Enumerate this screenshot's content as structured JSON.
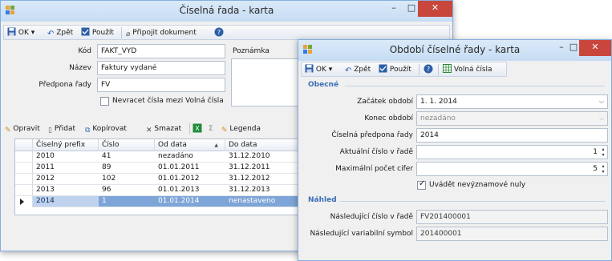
{
  "main_window": {
    "title": "Číselná řada - karta",
    "toolbar": {
      "ok_label": "OK",
      "back_label": "Zpět",
      "apply_label": "Použít",
      "attach_label": "Připojit dokument"
    },
    "form": {
      "kod_label": "Kód",
      "kod_value": "FAKT_VYD",
      "nazev_label": "Název",
      "nazev_value": "Faktury vydané",
      "predpona_label": "Předpona řady",
      "predpona_value": "FV",
      "poznamka_label": "Poznámka",
      "nevracet_label": "Nevracet čísla mezi Volná čísla"
    },
    "grid_toolbar": {
      "edit_label": "Opravit",
      "add_label": "Přidat",
      "copy_label": "Kopírovat",
      "delete_label": "Smazat",
      "legend_label": "Legenda"
    },
    "grid": {
      "columns": [
        "Číselný prefix",
        "Číslo",
        "Od data",
        "Do data"
      ],
      "rows": [
        {
          "prefix": "2010",
          "cislo": "41",
          "od": "nezadáno",
          "do": "31.12.2010"
        },
        {
          "prefix": "2011",
          "cislo": "89",
          "od": "01.01.2011",
          "do": "31.12.2011"
        },
        {
          "prefix": "2012",
          "cislo": "102",
          "od": "01.01.2012",
          "do": "31.12.2012"
        },
        {
          "prefix": "2013",
          "cislo": "96",
          "od": "01.01.2013",
          "do": "31.12.2013"
        },
        {
          "prefix": "2014",
          "cislo": "1",
          "od": "01.01.2014",
          "do": "nenastaveno"
        }
      ]
    }
  },
  "dialog": {
    "title": "Období číselné řady - karta",
    "toolbar": {
      "ok_label": "OK",
      "back_label": "Zpět",
      "apply_label": "Použít",
      "free_numbers_label": "Volná čísla"
    },
    "obecne_label": "Obecné",
    "zacatek_label": "Začátek období",
    "zacatek_value": "1. 1. 2014",
    "konec_label": "Konec období",
    "konec_value": "nezadáno",
    "predpona_label": "Číselná předpona řady",
    "predpona_value": "2014",
    "aktualni_label": "Aktuální číslo v řadě",
    "aktualni_value": "1",
    "max_cifer_label": "Maximální počet cifer",
    "max_cifer_value": "5",
    "uvadet_label": "Uvádět nevýznamové nuly",
    "nahled_label": "Náhled",
    "nasledujici_cislo_label": "Následující číslo v řadě",
    "nasledujici_cislo_value": "FV201400001",
    "nasledujici_vs_label": "Následující variabilní symbol",
    "nasledujici_vs_value": "201400001"
  }
}
